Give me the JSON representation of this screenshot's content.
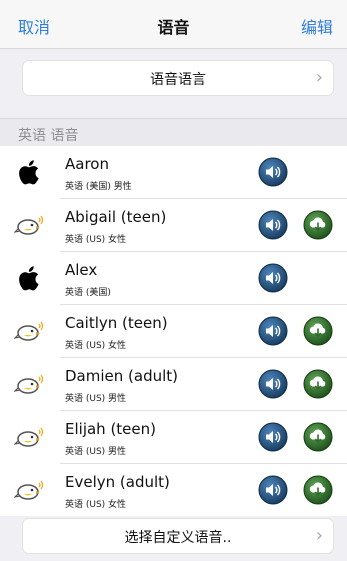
{
  "nav": {
    "cancel": "取消",
    "title": "语音",
    "edit": "编辑"
  },
  "voice_language": {
    "label": "语音语言",
    "chevron_icon": "chevron-right-icon"
  },
  "section": {
    "title": "英语 语音"
  },
  "voices": [
    {
      "name": "Aaron",
      "meta": "英语 (美国) 男性",
      "icon": "apple-logo-icon",
      "downloadable": false
    },
    {
      "name": "Abigail (teen)",
      "meta": "英语 (US) 女性",
      "icon": "bird-icon",
      "downloadable": true
    },
    {
      "name": "Alex",
      "meta": "英语 (美国)",
      "icon": "apple-logo-icon",
      "downloadable": false
    },
    {
      "name": "Caitlyn (teen)",
      "meta": "英语 (US) 女性",
      "icon": "bird-icon",
      "downloadable": true
    },
    {
      "name": "Damien (adult)",
      "meta": "英语 (US) 男性",
      "icon": "bird-icon",
      "downloadable": true
    },
    {
      "name": "Elijah (teen)",
      "meta": "英语 (US) 男性",
      "icon": "bird-icon",
      "downloadable": true
    },
    {
      "name": "Evelyn (adult)",
      "meta": "英语 (US) 女性",
      "icon": "bird-icon",
      "downloadable": true
    }
  ],
  "custom_voice": {
    "label": "选择自定义语音..",
    "chevron_icon": "chevron-right-icon"
  },
  "colors": {
    "accent": "#2f7de1",
    "play_button": "#1f4e7a",
    "download_button": "#2f6b2a"
  }
}
